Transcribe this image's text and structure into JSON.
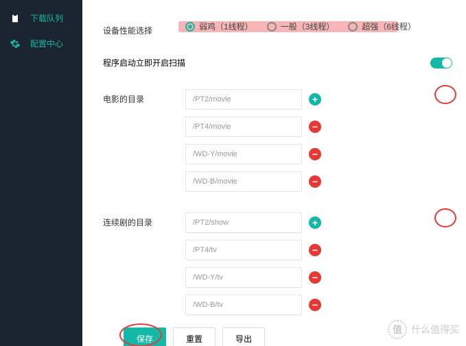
{
  "sidebar": {
    "items": [
      {
        "label": "下载队列",
        "icon": "clipboard"
      },
      {
        "label": "配置中心",
        "icon": "gear"
      }
    ]
  },
  "settings": {
    "performance_label": "设备性能选择",
    "performance_options": [
      {
        "label": "弱鸡（1线程）",
        "selected": true
      },
      {
        "label": "一般（3线程）",
        "selected": false
      },
      {
        "label": "超强（6线程）",
        "selected": false
      }
    ],
    "auto_scan_label": "程序启动立即开启扫描",
    "auto_scan_on": true,
    "movie_label": "电影的目录",
    "movie_paths": [
      "/PT2/movie",
      "/PT4/movie",
      "/WD-Y/movie",
      "/WD-B/movie"
    ],
    "series_label": "连续剧的目录",
    "series_paths": [
      "/PT2/show",
      "/PT4/tv",
      "/WD-Y/tv",
      "/WD-B/tv"
    ]
  },
  "actions": {
    "save": "保存",
    "reset": "重置",
    "export": "导出"
  },
  "watermark": {
    "logo": "值",
    "text": "什么值得买"
  }
}
